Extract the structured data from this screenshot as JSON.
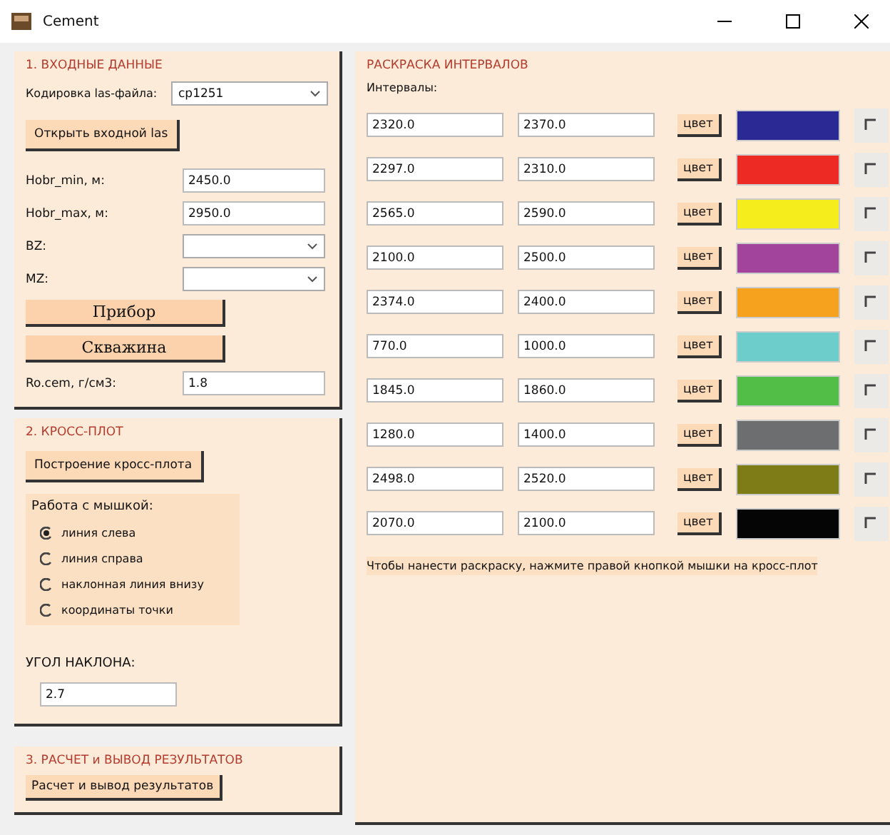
{
  "window": {
    "title": "Cement"
  },
  "input_section": {
    "title": "1. ВХОДНЫЕ ДАННЫЕ",
    "encoding": {
      "label": "Кодировка las-файла:",
      "value": "cp1251"
    },
    "open_button": "Открыть входной las",
    "fields": [
      {
        "kind": "text",
        "label": "Hobr_min, м:",
        "value": "2450.0"
      },
      {
        "kind": "text",
        "label": "Hobr_max, м:",
        "value": "2950.0"
      },
      {
        "kind": "select",
        "label": "BZ:"
      },
      {
        "kind": "select",
        "label": "MZ:"
      }
    ],
    "big_buttons": [
      "Прибор",
      "Скважина"
    ],
    "density": {
      "label": "Ro.cem, г/см3:",
      "value": "1.8"
    }
  },
  "crossplot_section": {
    "title": "2. КРОСС-ПЛОТ",
    "build_button": "Построение кросс-плота",
    "mouse_label": "Работа с мышкой:",
    "modes": [
      {
        "label": "линия слева",
        "selected": true
      },
      {
        "label": "линия справа",
        "selected": false
      },
      {
        "label": "наклонная линия внизу",
        "selected": false
      },
      {
        "label": "координаты точки",
        "selected": false
      }
    ],
    "angle": {
      "label": "УГОЛ НАКЛОНА:",
      "value": "2.7"
    }
  },
  "results_section": {
    "title": "3. РАСЧЕТ и ВЫВОД РЕЗУЛЬТАТОВ",
    "button": "Расчет и вывод результатов"
  },
  "coloring_section": {
    "title": "РАСКРАСКА ИНТЕРВАЛОВ",
    "intervals_label": "Интервалы:",
    "intervals": [
      {
        "from": "2320.0",
        "to": "2370.0",
        "button": "цвет",
        "color": "#2b2a95",
        "checked": false
      },
      {
        "from": "2297.0",
        "to": "2310.0",
        "button": "цвет",
        "color": "#ee2a24",
        "checked": false
      },
      {
        "from": "2565.0",
        "to": "2590.0",
        "button": "цвет",
        "color": "#f6ee1c",
        "checked": false
      },
      {
        "from": "2100.0",
        "to": "2500.0",
        "button": "цвет",
        "color": "#a2449c",
        "checked": false
      },
      {
        "from": "2374.0",
        "to": "2400.0",
        "button": "цвет",
        "color": "#f6a21e",
        "checked": false
      },
      {
        "from": "770.0",
        "to": "1000.0",
        "button": "цвет",
        "color": "#6ccdcb",
        "checked": false
      },
      {
        "from": "1845.0",
        "to": "1860.0",
        "button": "цвет",
        "color": "#52bd47",
        "checked": false
      },
      {
        "from": "1280.0",
        "to": "1400.0",
        "button": "цвет",
        "color": "#6d6e70",
        "checked": false
      },
      {
        "from": "2498.0",
        "to": "2520.0",
        "button": "цвет",
        "color": "#7d7c17",
        "checked": false
      },
      {
        "from": "2070.0",
        "to": "2100.0",
        "button": "цвет",
        "color": "#050505",
        "checked": false
      }
    ],
    "hint": "Чтобы нанести раскраску, нажмите правой кнопкой мышки на кросс-плот"
  }
}
